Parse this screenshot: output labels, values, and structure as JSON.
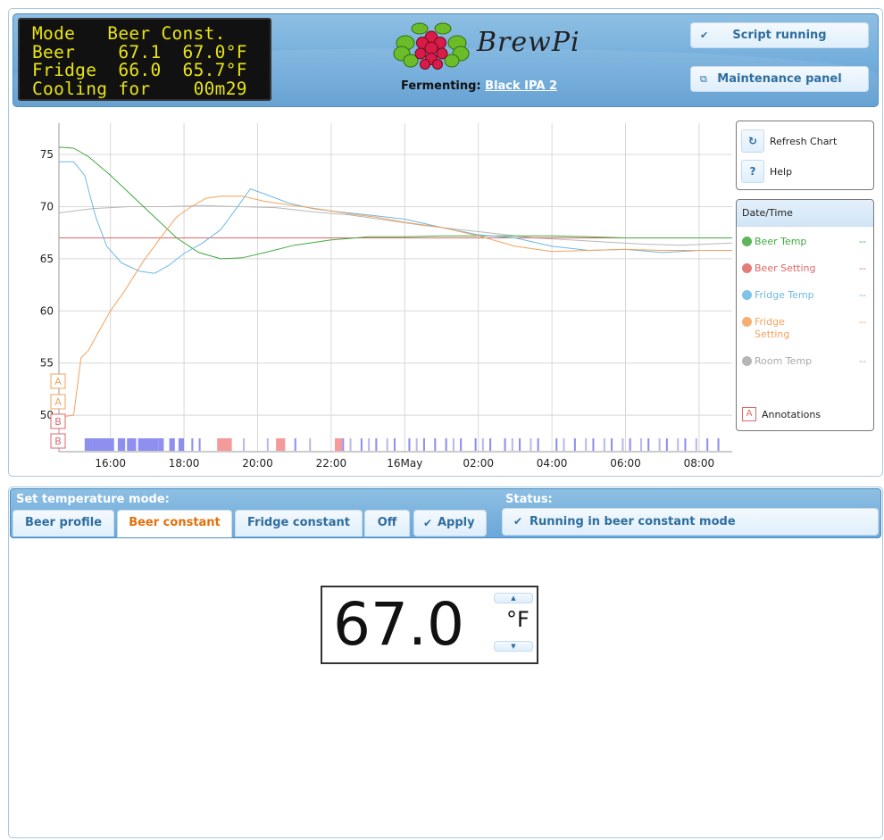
{
  "lcd": {
    "lines": [
      "Mode   Beer Const.",
      "Beer    67.1  67.0°F",
      "Fridge  66.0  65.7°F",
      "Cooling for    00m29"
    ]
  },
  "header": {
    "logo_text": "BrewPi",
    "fermenting_label": "Fermenting:",
    "beer_name": "Black IPA 2",
    "script_button": "Script running",
    "maintenance_button": "Maintenance panel"
  },
  "chart_controls": {
    "refresh_label": "Refresh Chart",
    "help_label": "Help",
    "refresh_icon": "↻",
    "help_icon": "?"
  },
  "legend": {
    "header": "Date/Time",
    "items": [
      {
        "name": "Beer Temp",
        "value": "--",
        "color": "#41a940"
      },
      {
        "name": "Beer Setting",
        "value": "--",
        "color": "#e06666"
      },
      {
        "name": "Fridge Temp",
        "value": "--",
        "color": "#6cb8e6"
      },
      {
        "name": "Fridge\nSetting",
        "value": "--",
        "color": "#f3a25b"
      },
      {
        "name": "Room Temp",
        "value": "--",
        "color": "#aaaaaa"
      }
    ],
    "annotations_label": "Annotations",
    "annotations_icon": "A"
  },
  "chart_data": {
    "type": "line",
    "x_tick_labels": [
      "16:00",
      "18:00",
      "20:00",
      "22:00",
      "16May",
      "02:00",
      "04:00",
      "06:00",
      "08:00"
    ],
    "x_tick_hours": [
      16,
      18,
      20,
      22,
      24,
      26,
      28,
      30,
      32
    ],
    "x_range_hours": [
      14.6,
      32.9
    ],
    "ylim": [
      46.5,
      78
    ],
    "y_ticks": [
      50,
      55,
      60,
      65,
      70,
      75
    ],
    "grid": true,
    "series": [
      {
        "name": "Beer Temp",
        "color": "#41a940",
        "points": [
          [
            14.6,
            75.7
          ],
          [
            15.0,
            75.6
          ],
          [
            15.4,
            74.8
          ],
          [
            16.0,
            73.0
          ],
          [
            16.6,
            71.0
          ],
          [
            17.2,
            69.0
          ],
          [
            17.8,
            67.0
          ],
          [
            18.4,
            65.6
          ],
          [
            19.0,
            65.0
          ],
          [
            19.6,
            65.1
          ],
          [
            20.2,
            65.6
          ],
          [
            21.0,
            66.3
          ],
          [
            22.0,
            66.8
          ],
          [
            23.0,
            67.1
          ],
          [
            24.0,
            67.1
          ],
          [
            25.0,
            67.2
          ],
          [
            26.0,
            67.2
          ],
          [
            27.0,
            67.2
          ],
          [
            28.0,
            67.2
          ],
          [
            29.0,
            67.1
          ],
          [
            30.0,
            67.0
          ],
          [
            31.0,
            67.0
          ],
          [
            32.0,
            67.0
          ],
          [
            32.9,
            67.0
          ]
        ]
      },
      {
        "name": "Beer Setting",
        "color": "#e06666",
        "points": [
          [
            14.6,
            67.0
          ],
          [
            32.9,
            67.0
          ]
        ]
      },
      {
        "name": "Fridge Temp",
        "color": "#6cb8e6",
        "points": [
          [
            14.6,
            74.3
          ],
          [
            15.0,
            74.3
          ],
          [
            15.3,
            73.0
          ],
          [
            15.6,
            69.0
          ],
          [
            15.9,
            66.2
          ],
          [
            16.3,
            64.6
          ],
          [
            16.8,
            63.8
          ],
          [
            17.2,
            63.6
          ],
          [
            17.6,
            64.4
          ],
          [
            18.0,
            65.5
          ],
          [
            18.5,
            66.5
          ],
          [
            19.0,
            67.8
          ],
          [
            19.5,
            70.2
          ],
          [
            19.8,
            71.7
          ],
          [
            20.2,
            71.2
          ],
          [
            20.8,
            70.4
          ],
          [
            21.5,
            69.8
          ],
          [
            22.2,
            69.5
          ],
          [
            23.0,
            69.2
          ],
          [
            24.0,
            68.8
          ],
          [
            25.0,
            68.0
          ],
          [
            26.0,
            67.3
          ],
          [
            27.0,
            67.0
          ],
          [
            28.0,
            66.2
          ],
          [
            29.0,
            65.8
          ],
          [
            30.0,
            65.9
          ],
          [
            31.0,
            65.6
          ],
          [
            32.0,
            65.8
          ],
          [
            32.9,
            65.8
          ]
        ]
      },
      {
        "name": "Fridge Setting",
        "color": "#f3a25b",
        "points": [
          [
            14.6,
            49.8
          ],
          [
            15.0,
            50.0
          ],
          [
            15.2,
            55.5
          ],
          [
            15.4,
            56.2
          ],
          [
            15.6,
            57.5
          ],
          [
            16.0,
            60.0
          ],
          [
            16.4,
            62.0
          ],
          [
            16.9,
            64.8
          ],
          [
            17.4,
            67.2
          ],
          [
            17.8,
            69.0
          ],
          [
            18.2,
            70.0
          ],
          [
            18.6,
            70.8
          ],
          [
            19.0,
            71.0
          ],
          [
            19.6,
            71.0
          ],
          [
            20.2,
            70.5
          ],
          [
            21.0,
            70.1
          ],
          [
            21.8,
            69.7
          ],
          [
            22.5,
            69.3
          ],
          [
            23.2,
            69.0
          ],
          [
            24.0,
            68.5
          ],
          [
            25.0,
            68.0
          ],
          [
            26.0,
            67.2
          ],
          [
            27.0,
            66.2
          ],
          [
            28.0,
            65.7
          ],
          [
            29.0,
            65.8
          ],
          [
            30.0,
            65.9
          ],
          [
            31.0,
            65.8
          ],
          [
            32.0,
            65.8
          ],
          [
            32.9,
            65.8
          ]
        ]
      },
      {
        "name": "Room Temp",
        "color": "#b8b8b8",
        "points": [
          [
            14.6,
            69.4
          ],
          [
            15.5,
            69.8
          ],
          [
            16.5,
            70.0
          ],
          [
            17.5,
            70.0
          ],
          [
            18.5,
            70.1
          ],
          [
            19.5,
            70.0
          ],
          [
            20.5,
            69.9
          ],
          [
            21.5,
            69.5
          ],
          [
            22.5,
            69.2
          ],
          [
            23.5,
            68.7
          ],
          [
            24.5,
            68.2
          ],
          [
            25.5,
            67.8
          ],
          [
            26.5,
            67.4
          ],
          [
            27.5,
            67.0
          ],
          [
            28.5,
            66.8
          ],
          [
            29.5,
            66.6
          ],
          [
            30.5,
            66.4
          ],
          [
            31.5,
            66.3
          ],
          [
            32.9,
            66.5
          ]
        ]
      }
    ],
    "annotation_markers": [
      "A",
      "A",
      "B",
      "B"
    ],
    "state_bands": {
      "cooling_hours": [
        [
          15.3,
          15.5
        ],
        [
          15.5,
          16.1
        ],
        [
          16.2,
          16.4
        ],
        [
          16.45,
          16.7
        ],
        [
          16.75,
          17.3
        ],
        [
          17.3,
          17.45
        ],
        [
          17.6,
          17.75
        ],
        [
          17.85,
          18.0
        ],
        [
          18.2,
          18.25
        ],
        [
          18.4,
          18.45
        ],
        [
          21.0,
          21.05
        ],
        [
          22.3,
          22.35
        ],
        [
          22.8,
          22.85
        ],
        [
          23.2,
          23.25
        ],
        [
          23.7,
          23.75
        ],
        [
          24.1,
          24.15
        ],
        [
          24.5,
          24.55
        ],
        [
          24.8,
          24.85
        ],
        [
          25.1,
          25.15
        ],
        [
          25.5,
          25.55
        ],
        [
          25.9,
          25.95
        ],
        [
          26.3,
          26.35
        ],
        [
          26.7,
          26.75
        ],
        [
          27.1,
          27.15
        ],
        [
          27.6,
          27.65
        ],
        [
          28.1,
          28.15
        ],
        [
          28.6,
          28.65
        ],
        [
          29.1,
          29.15
        ],
        [
          29.6,
          29.65
        ],
        [
          30.1,
          30.15
        ],
        [
          30.6,
          30.65
        ],
        [
          31.1,
          31.15
        ],
        [
          31.6,
          31.65
        ],
        [
          32.2,
          32.25
        ],
        [
          32.5,
          32.55
        ]
      ],
      "heating_hours": [
        [
          18.9,
          19.3
        ],
        [
          20.5,
          20.75
        ],
        [
          22.1,
          22.3
        ]
      ],
      "idle_hours": [
        [
          19.6,
          19.65
        ],
        [
          20.25,
          20.3
        ],
        [
          21.4,
          21.45
        ],
        [
          22.5,
          22.55
        ],
        [
          23.0,
          23.05
        ],
        [
          23.5,
          23.55
        ],
        [
          24.3,
          24.35
        ],
        [
          25.3,
          25.35
        ],
        [
          26.1,
          26.15
        ],
        [
          26.9,
          26.95
        ],
        [
          27.4,
          27.45
        ],
        [
          28.3,
          28.35
        ],
        [
          28.9,
          28.95
        ],
        [
          29.4,
          29.45
        ],
        [
          29.9,
          29.95
        ],
        [
          30.4,
          30.45
        ],
        [
          30.9,
          30.95
        ],
        [
          31.4,
          31.45
        ],
        [
          31.9,
          31.95
        ]
      ],
      "cooling_color": "#8f8ff0",
      "heating_color": "#f59a9a",
      "idle_color": "#b9b9e8"
    }
  },
  "mode_panel": {
    "title": "Set temperature mode:",
    "tabs": [
      "Beer profile",
      "Beer constant",
      "Fridge constant",
      "Off"
    ],
    "active_tab": "Beer constant",
    "apply_label": "Apply",
    "status_title": "Status:",
    "status_text": "Running in beer constant mode"
  },
  "temperature_setting": {
    "value": "67.0",
    "unit": "°F"
  },
  "colors": {
    "accent": "#2e6e9e",
    "active_tab": "#e17009",
    "lcd_text": "#e8e314"
  }
}
